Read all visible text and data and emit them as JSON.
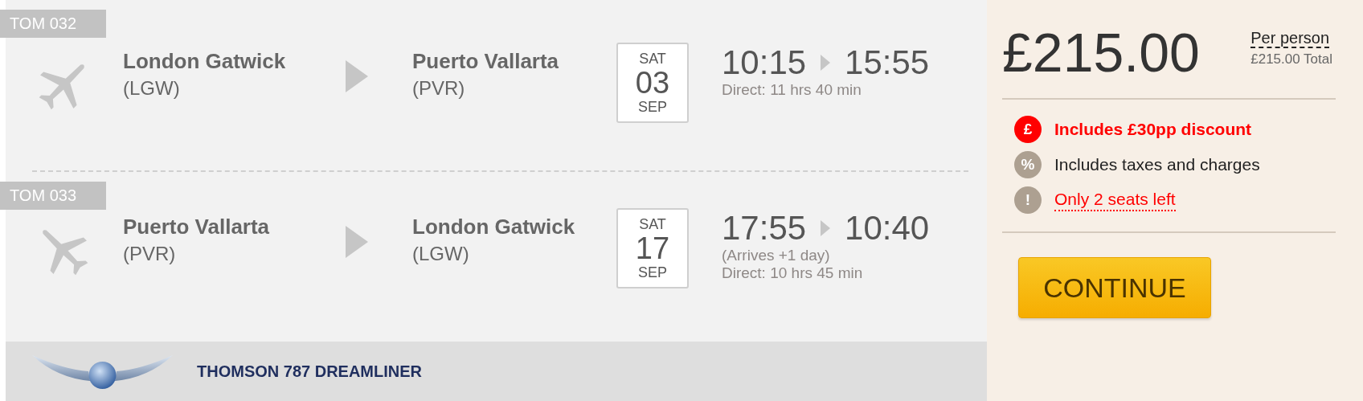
{
  "flights": [
    {
      "flight_number": "TOM 032",
      "kind": "outbound",
      "origin": {
        "city": "London Gatwick",
        "code": "(LGW)"
      },
      "destination": {
        "city": "Puerto Vallarta",
        "code": "(PVR)"
      },
      "date": {
        "weekday": "SAT",
        "day": "03",
        "month": "SEP"
      },
      "depart": "10:15",
      "arrive": "15:55",
      "notes": [
        "Direct: 11 hrs 40 min"
      ]
    },
    {
      "flight_number": "TOM 033",
      "kind": "inbound",
      "origin": {
        "city": "Puerto Vallarta",
        "code": "(PVR)"
      },
      "destination": {
        "city": "London Gatwick",
        "code": "(LGW)"
      },
      "date": {
        "weekday": "SAT",
        "day": "17",
        "month": "SEP"
      },
      "depart": "17:55",
      "arrive": "10:40",
      "notes": [
        "(Arrives +1 day)",
        "Direct: 10 hrs 45 min"
      ]
    }
  ],
  "aircraft": {
    "name": "THOMSON 787 DREAMLINER"
  },
  "price": {
    "amount": "£215.00",
    "per_person": "Per person",
    "total": "£215.00 Total"
  },
  "features": [
    {
      "kind": "discount",
      "icon": "£",
      "text": "Includes £30pp discount"
    },
    {
      "kind": "info",
      "icon": "%",
      "text": "Includes taxes and charges"
    },
    {
      "kind": "warning",
      "icon": "!",
      "text": "Only 2 seats left"
    }
  ],
  "button": "CONTINUE"
}
